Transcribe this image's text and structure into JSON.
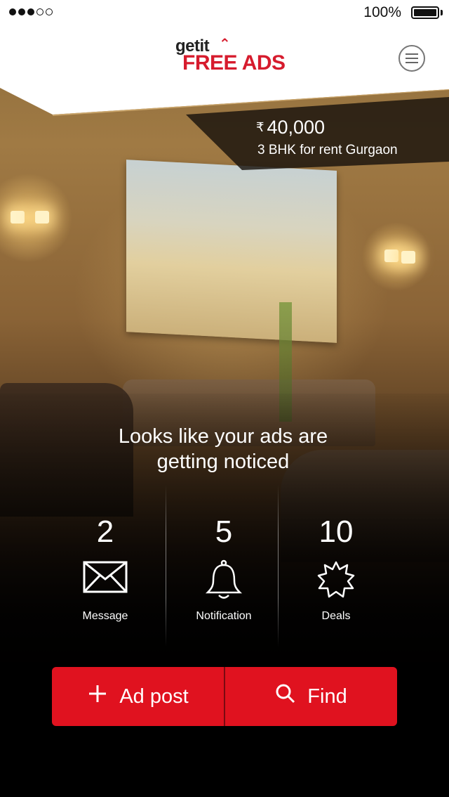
{
  "status_bar": {
    "signal_dots_filled": 3,
    "signal_dots_total": 5,
    "battery_percent": "100%"
  },
  "header": {
    "logo_top": "getit",
    "logo_bottom": "FREE ADS",
    "menu_icon": "hamburger-menu-icon"
  },
  "featured": {
    "currency_symbol": "₹",
    "price": "40,000",
    "title": "3 BHK for rent Gurgaon"
  },
  "headline": {
    "line1": "Looks like your ads are",
    "line2": "getting noticed"
  },
  "stats": [
    {
      "count": "2",
      "label": "Message",
      "icon": "envelope-icon"
    },
    {
      "count": "5",
      "label": "Notification",
      "icon": "bell-icon"
    },
    {
      "count": "10",
      "label": "Deals",
      "icon": "badge-star-icon"
    }
  ],
  "actions": {
    "ad_post_label": "Ad post",
    "ad_post_icon": "plus-icon",
    "find_label": "Find",
    "find_icon": "search-icon"
  },
  "colors": {
    "brand_red": "#e0121f",
    "logo_red": "#d61b2d"
  }
}
